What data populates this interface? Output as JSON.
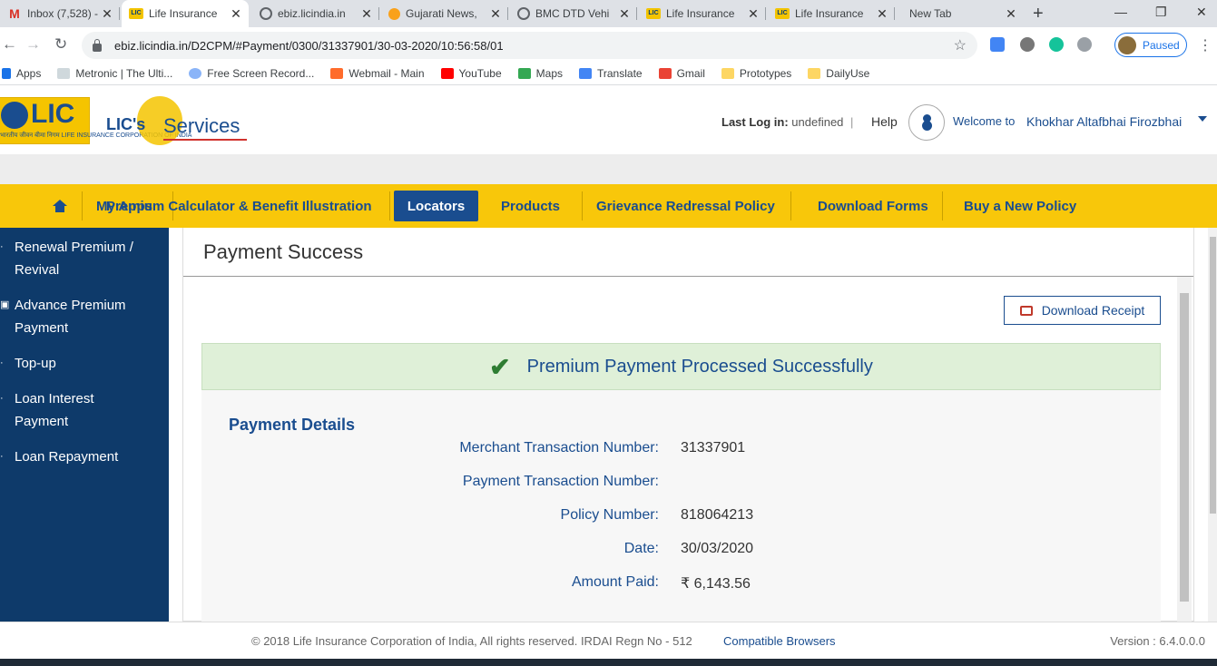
{
  "browser": {
    "tabs": [
      {
        "title": "Inbox (7,528) -",
        "icon": "gmail-icon",
        "active": false
      },
      {
        "title": "Life Insurance",
        "icon": "lic-favicon",
        "active": true
      },
      {
        "title": "ebiz.licindia.in",
        "icon": "globe-icon",
        "active": false
      },
      {
        "title": "Gujarati News,",
        "icon": "orange-circle-icon",
        "active": false
      },
      {
        "title": "BMC DTD Vehi",
        "icon": "globe-icon",
        "active": false
      },
      {
        "title": "Life Insurance",
        "icon": "lic-favicon",
        "active": false
      },
      {
        "title": "Life Insurance",
        "icon": "lic-favicon",
        "active": false
      },
      {
        "title": "New Tab",
        "icon": "",
        "active": false
      }
    ],
    "url": "ebiz.licindia.in/D2CPM/#Payment/0300/31337901/30-03-2020/10:56:58/01",
    "profile_status": "Paused",
    "bookmarks": [
      {
        "label": "Apps",
        "icon": "apps-grid-icon"
      },
      {
        "label": "Metronic | The Ulti...",
        "icon": "page-icon"
      },
      {
        "label": "Free Screen Record...",
        "icon": "record-icon"
      },
      {
        "label": "Webmail - Main",
        "icon": "cpanel-icon"
      },
      {
        "label": "YouTube",
        "icon": "youtube-icon"
      },
      {
        "label": "Maps",
        "icon": "maps-icon"
      },
      {
        "label": "Translate",
        "icon": "translate-icon"
      },
      {
        "label": "Gmail",
        "icon": "gmail-icon"
      },
      {
        "label": "Prototypes",
        "icon": "folder-icon"
      },
      {
        "label": "DailyUse",
        "icon": "folder-icon"
      }
    ]
  },
  "header": {
    "logo_text": "LIC",
    "logo_subtitle": "भारतीय जीवन बीमा निगम LIFE INSURANCE CORPORATION OF INDIA",
    "eservices_prefix": "LIC's",
    "eservices_suffix": "Services",
    "last_login_label": "Last Log in:",
    "last_login_value": "undefined",
    "help": "Help",
    "welcome": "Welcome to",
    "username": "Khokhar Altafbhai Firozbhai"
  },
  "nav": {
    "items": [
      "My Apps",
      "Premium Calculator & Benefit Illustration",
      "Locators",
      "Products",
      "Grievance Redressal Policy",
      "Download Forms",
      "Buy a New Policy"
    ],
    "active": "Locators"
  },
  "sidebar": {
    "items": [
      "Renewal Premium / Revival",
      "Advance Premium Payment",
      "Top-up",
      "Loan Interest Payment",
      "Loan Repayment"
    ]
  },
  "main": {
    "title": "Payment Success",
    "download_button": "Download Receipt",
    "success_message": "Premium Payment Processed Successfully",
    "details_title": "Payment Details",
    "rows": [
      {
        "label": "Merchant Transaction Number:",
        "value": "31337901"
      },
      {
        "label": "Payment Transaction Number:",
        "value": ""
      },
      {
        "label": "Policy Number:",
        "value": "818064213"
      },
      {
        "label": "Date:",
        "value": "30/03/2020"
      },
      {
        "label": "Amount Paid:",
        "value": "₹ 6,143.56"
      }
    ]
  },
  "footer": {
    "copyright": "© 2018 Life Insurance Corporation of India, All rights reserved. IRDAI Regn No - 512",
    "compatible": "Compatible Browsers",
    "version": "Version : 6.4.0.0.0"
  },
  "colors": {
    "brand_blue": "#1a4d8f",
    "nav_yellow": "#f8c70a",
    "sidebar_navy": "#0e3a6a",
    "success_green": "#dff0d8"
  }
}
